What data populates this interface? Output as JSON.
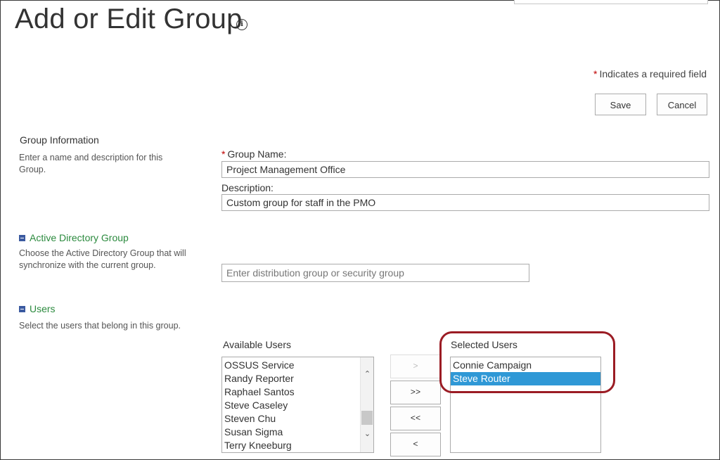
{
  "page": {
    "title": "Add or Edit Group",
    "required_note": "Indicates a required field",
    "required_star": "*"
  },
  "actions": {
    "save_label": "Save",
    "cancel_label": "Cancel"
  },
  "group_info": {
    "title": "Group Information",
    "description": "Enter a name and description for this Group.",
    "name_label": "Group Name:",
    "name_value": "Project Management Office",
    "description_label": "Description:",
    "description_value": "Custom group for staff in the PMO"
  },
  "active_directory": {
    "title": "Active Directory Group",
    "description": "Choose the Active Directory Group that will synchronize with the current group.",
    "placeholder": "Enter distribution group or security group"
  },
  "users": {
    "title": "Users",
    "description": "Select the users that belong in this group.",
    "available_label": "Available Users",
    "selected_label": "Selected Users",
    "available": [
      "OSSUS Service",
      "Randy Reporter",
      "Raphael Santos",
      "Steve Caseley",
      "Steven Chu",
      "Susan Sigma",
      "Terry Kneeburg"
    ],
    "selected": [
      {
        "name": "Connie Campaign",
        "highlighted": false
      },
      {
        "name": "Steve Router",
        "highlighted": true
      }
    ],
    "move_buttons": {
      "add": ">",
      "add_all": ">>",
      "remove_all": "<<",
      "remove": "<"
    }
  },
  "colors": {
    "accent_green": "#2b8a3e",
    "selection_blue": "#2f98d6",
    "highlight_ring": "#9b1c24",
    "required_red": "#bf0000"
  }
}
